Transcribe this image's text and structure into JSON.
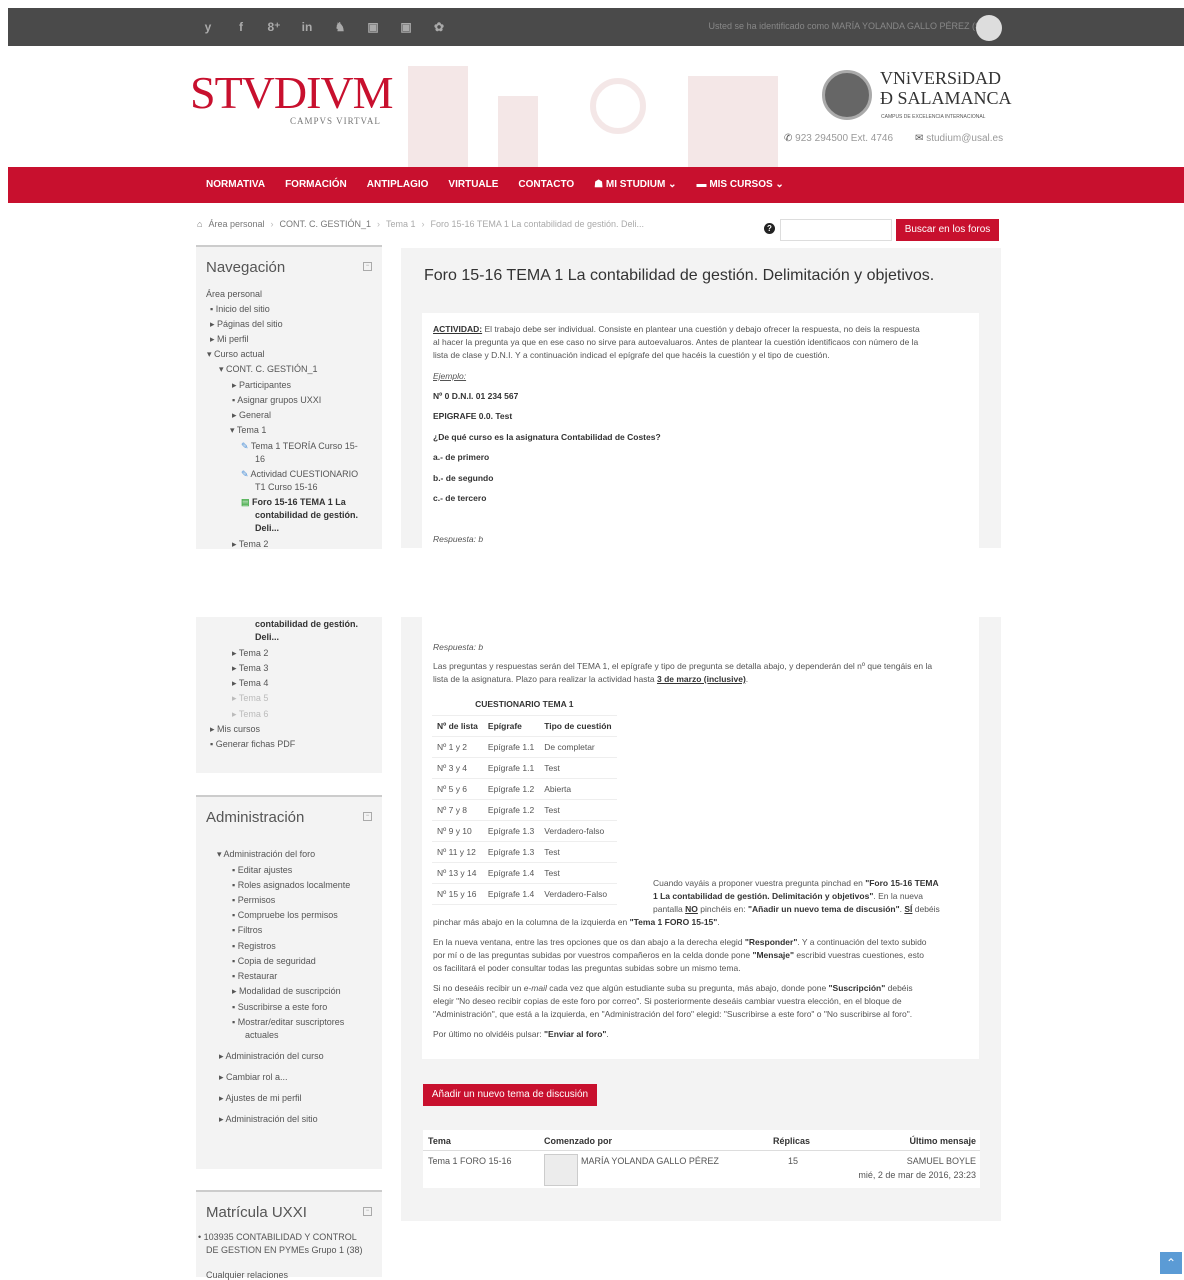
{
  "topbar": {
    "social": [
      "y",
      "f",
      "8⁺",
      "in",
      "♞",
      "▣",
      "▣",
      "✿"
    ],
    "logged_in": "Usted se ha identificado como MARÍA YOLANDA GALLO PÉREZ (Salir)"
  },
  "header": {
    "logo": "STVDIVM",
    "campus": "CAMPVS VIRTVAL",
    "university_line1": "VNiVERSiDAD",
    "university_line2": "Ð SALAMANCA",
    "university_sub": "CAMPUS DE EXCELENCIA INTERNACIONAL",
    "phone": "923 294500 Ext. 4746",
    "email": "studium@usal.es"
  },
  "nav": [
    "NORMATIVA",
    "FORMACIÓN",
    "ANTIPLAGIO",
    "VIRTUALE",
    "CONTACTO",
    "MI STUDIUM ⌄",
    "MIS CURSOS ⌄"
  ],
  "breadcrumb": {
    "items": [
      "Área personal",
      "CONT. C. GESTIÓN_1",
      "Tema 1"
    ],
    "current": "Foro 15-16 TEMA 1 La contabilidad de gestión. Deli..."
  },
  "search": {
    "button": "Buscar en los foros",
    "value": ""
  },
  "navigation": {
    "title": "Navegación",
    "items1": [
      "Área personal",
      "Inicio del sitio",
      "Páginas del sitio",
      "Mi perfil",
      "Curso actual",
      "CONT. C. GESTIÓN_1",
      "Participantes",
      "Asignar grupos UXXI",
      "General",
      "Tema 1",
      "Tema 1 TEORÍA Curso 15-",
      "16",
      "Actividad CUESTIONARIO",
      "T1 Curso 15-16",
      "Foro 15-16 TEMA 1 La",
      "contabilidad de gestión.",
      "Deli...",
      "Tema 2"
    ],
    "items2": [
      "contabilidad de gestión.",
      "Deli...",
      "Tema 2",
      "Tema 3",
      "Tema 4",
      "Tema 5",
      "Tema 6",
      "Mis cursos",
      "Generar fichas PDF"
    ]
  },
  "admin": {
    "title": "Administración",
    "items": [
      "Administración del foro",
      "Editar ajustes",
      "Roles asignados localmente",
      "Permisos",
      "Compruebe los permisos",
      "Filtros",
      "Registros",
      "Copia de seguridad",
      "Restaurar",
      "Modalidad de suscripción",
      "Suscribirse a este foro",
      "Mostrar/editar suscriptores",
      "actuales",
      "Administración del curso",
      "Cambiar rol a...",
      "Ajustes de mi perfil",
      "Administración del sitio"
    ]
  },
  "matricula": {
    "title": "Matrícula UXXI",
    "line1": "• 103935 CONTABILIDAD Y CONTROL",
    "line2": "DE GESTION EN PYMEs Grupo 1 (38)",
    "line3": "Cualquier relaciones"
  },
  "forum": {
    "title": "Foro 15-16 TEMA 1 La contabilidad de gestión. Delimitación y objetivos.",
    "actividad_label": "ACTIVIDAD:",
    "actividad_l1": "El trabajo debe ser individual. Consiste en plantear una cuestión y debajo ofrecer la respuesta, no deis la respuesta",
    "actividad_l2": "al hacer la pregunta ya que en ese caso no sirve para autoevaluaros. Antes de plantear la cuestión identificaos con número de la",
    "actividad_l3": "lista de clase y D.N.I. Y a continuación indicad el epígrafe del que hacéis la cuestión y el tipo de cuestión.",
    "ejemplo": "Ejemplo:",
    "nd": "Nº 0 D.N.I. 01 234 567",
    "epigrafe": "EPIGRAFE 0.0. Test",
    "question": "¿De qué curso es la asignatura Contabilidad de Costes?",
    "a": "a.- de primero",
    "b": "b.- de segundo",
    "c": "c.- de tercero",
    "respuesta": "Respuesta: b",
    "p1_l1": "Las preguntas y respuestas serán del TEMA 1, el epígrafe y tipo de pregunta se detalla abajo, y dependerán del nº que tengáis en la",
    "p1_l2a": "lista de la asignatura. Plazo para realizar la actividad hasta",
    "p1_l2b": "3 de marzo (inclusive)",
    "p1_l2c": ".",
    "table_caption": "CUESTIONARIO   TEMA 1",
    "table_headers": [
      "Nº de lista",
      "Epígrafe",
      "Tipo de cuestión"
    ],
    "table_rows": [
      [
        "Nº  1 y 2",
        "Epígrafe  1.1",
        "De  completar"
      ],
      [
        "Nº  3 y 4",
        "Epígrafe  1.1",
        "Test"
      ],
      [
        "Nº  5 y 6",
        "Epígrafe  1.2",
        "Abierta"
      ],
      [
        "Nº  7 y 8",
        "Epígrafe  1.2",
        "Test"
      ],
      [
        "Nº  9 y 10",
        "Epígrafe  1.3",
        "Verdadero-falso"
      ],
      [
        "Nº  11 y 12",
        "Epígrafe  1.3",
        "Test"
      ],
      [
        "Nº  13 y 14",
        "Epígrafe  1.4",
        "Test"
      ],
      [
        "Nº  15 y 16",
        "Epígrafe  1.4",
        "Verdadero-Falso"
      ]
    ],
    "p2_l1a": "Cuando vayáis a proponer vuestra pregunta pinchad en ",
    "p2_l1b": "\"Foro 15-16 TEMA",
    "p2_l2a": "1 La contabilidad de gestión. Delimitación y objetivos\"",
    "p2_l2b": ". En la nueva",
    "p2_l3a": "pantalla ",
    "p2_l3b": "NO",
    "p2_l3c": " pinchéis en: ",
    "p2_l3d": "\"Añadir un nuevo tema de discusión\"",
    "p2_l3e": ". ",
    "p2_l3f": "SÍ",
    "p2_l3g": " debéis",
    "p2_l4a": "pinchar más abajo en la columna de la izquierda en ",
    "p2_l4b": "\"Tema 1 FORO 15-15\"",
    "p2_l4c": ".",
    "p3_l1a": "En la nueva ventana, entre las tres opciones que os dan abajo a la derecha elegid ",
    "p3_l1b": "\"Responder\"",
    "p3_l1c": ". Y a continuación del texto subido",
    "p3_l2a": "por mí o de las preguntas subidas por vuestros compañeros en la celda donde pone ",
    "p3_l2b": "\"Mensaje\"",
    "p3_l2c": " escribid vuestras cuestiones, esto",
    "p3_l3": "os facilitará el poder consultar todas las preguntas subidas sobre un mismo tema.",
    "p4_l1a": " Si no deseáis recibir un ",
    "p4_l1b": "e-mail",
    "p4_l1c": " cada vez que algún estudiante suba su pregunta, más abajo, donde pone ",
    "p4_l1d": "\"Suscripción\"",
    "p4_l1e": " debéis",
    "p4_l2": "elegir \"No deseo recibir copias de este foro por correo\". Si posteriormente deseáis cambiar vuestra elección, en el bloque de",
    "p4_l3": "\"Administración\", que está a la izquierda,  en \"Administración del foro\" elegid: \"Suscribirse a este foro\" o \"No suscribirse al foro\".",
    "p5a": "Por último no olvidéis pulsar: ",
    "p5b": "\"Enviar al foro\"",
    "p5c": ".",
    "add_button": "Añadir un nuevo tema de discusión"
  },
  "discussions": {
    "headers": [
      "Tema",
      "Comenzado por",
      "Réplicas",
      "Último mensaje"
    ],
    "row": {
      "tema": "Tema 1 FORO 15-16",
      "author": "MARÍA YOLANDA GALLO PÉREZ",
      "replies": "15",
      "last_user": "SAMUEL BOYLE",
      "last_date": "mié, 2 de mar de 2016, 23:23"
    }
  },
  "colors": {
    "accent": "#c8102e",
    "topbar": "#4a4a4a",
    "panel": "#f3f3f3"
  }
}
